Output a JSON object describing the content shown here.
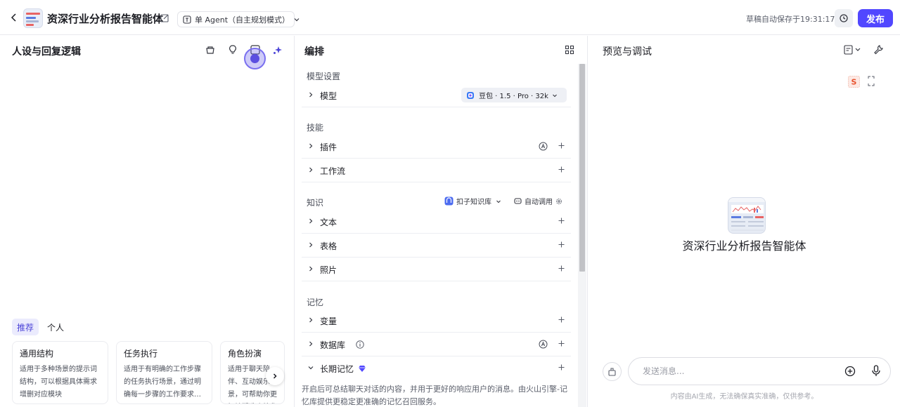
{
  "header": {
    "agent_title": "资深行业分析报告智能体",
    "mode_label": "单 Agent（自主规划模式）",
    "autosave_text": "草稿自动保存于19:31:17",
    "publish_label": "发布"
  },
  "left_panel": {
    "title": "人设与回复逻辑",
    "tabs": [
      {
        "label": "推荐",
        "active": true
      },
      {
        "label": "个人",
        "active": false
      }
    ],
    "templates": [
      {
        "title": "通用结构",
        "desc": "适用于多种场景的提示词结构，可以根据具体需求增删对应模块"
      },
      {
        "title": "任务执行",
        "desc": "适用于有明确的工作步骤的任务执行场景，通过明确每一步骤的工作要求…"
      },
      {
        "title": "角色扮演",
        "desc": "适用于聊天陪伴、互动娱乐场景，可帮助你更好地塑造个性化的人物"
      }
    ]
  },
  "mid_panel": {
    "title": "编排",
    "sections": {
      "model": {
        "label": "模型设置",
        "row_label": "模型",
        "model_name": "豆包 · 1.5 · Pro · 32k"
      },
      "skills": {
        "label": "技能",
        "rows": [
          "插件",
          "工作流"
        ]
      },
      "knowledge": {
        "label": "知识",
        "kb_label": "扣子知识库",
        "auto_label": "自动调用",
        "rows": [
          "文本",
          "表格",
          "照片"
        ]
      },
      "memory": {
        "label": "记忆",
        "rows": [
          "变量",
          "数据库",
          "长期记忆"
        ]
      }
    },
    "ltm_desc": "开启后可总结聊天对话的内容，并用于更好的响应用户的消息。由火山引擎-记忆库提供更稳定更准确的记忆召回服务。"
  },
  "right_panel": {
    "title": "预览与调试",
    "agent_name": "资深行业分析报告智能体",
    "input_placeholder": "发送消息...",
    "disclaimer": "内容由AI生成，无法确保真实准确，仅供参考。"
  },
  "colors": {
    "accent": "#5147ff",
    "badge": "#5b4fe0",
    "border": "#e8e9ee"
  }
}
